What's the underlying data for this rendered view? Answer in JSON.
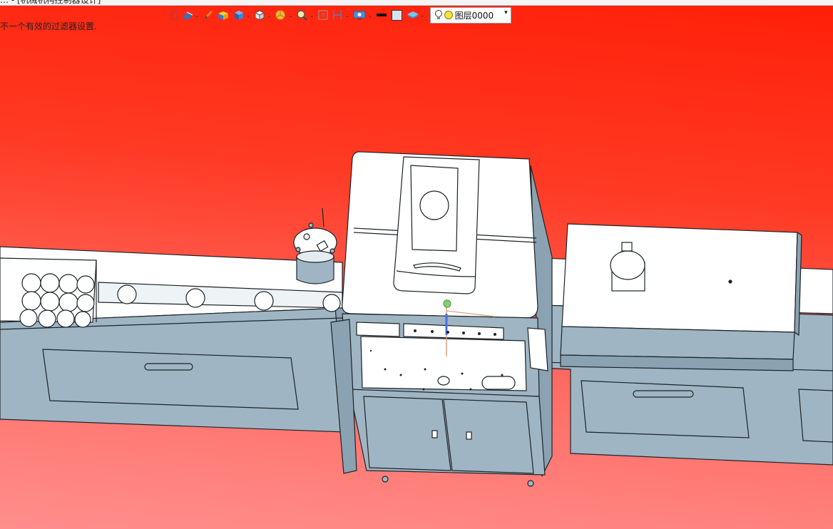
{
  "window": {
    "title": "… - [机械机构控制器设计]"
  },
  "status_message": "不一个有效的过滤器设置.",
  "toolbar": {
    "items": [
      {
        "icon": "exit-arrow-icon"
      },
      {
        "icon": "render-mode-icon",
        "dropdown": true
      },
      {
        "icon": "pen-icon"
      },
      {
        "icon": "box-tool-icon"
      },
      {
        "icon": "cube-icon",
        "dropdown": true
      },
      {
        "icon": "white-cube-icon",
        "dropdown": true
      },
      {
        "icon": "pie-chart-icon",
        "dropdown": true
      },
      {
        "icon": "zoom-icon",
        "dropdown": true
      },
      {
        "icon": "fit-view-icon"
      },
      {
        "icon": "section-icon",
        "dropdown": true
      },
      {
        "icon": "display-settings-icon",
        "dropdown": true
      },
      {
        "icon": "line-black-icon"
      },
      {
        "icon": "color-fill-icon"
      },
      {
        "icon": "layers-icon",
        "dropdown": true
      }
    ],
    "layer_selector": {
      "value": "图层0000",
      "icons": [
        "lightbulb-icon",
        "sun-icon"
      ]
    }
  },
  "colors": {
    "model_fill": "#9fb5c4",
    "model_top": "#ffffff",
    "model_edge": "#1d2327",
    "background_top": "#ff1f08",
    "background_bottom": "#ff8e8c"
  }
}
